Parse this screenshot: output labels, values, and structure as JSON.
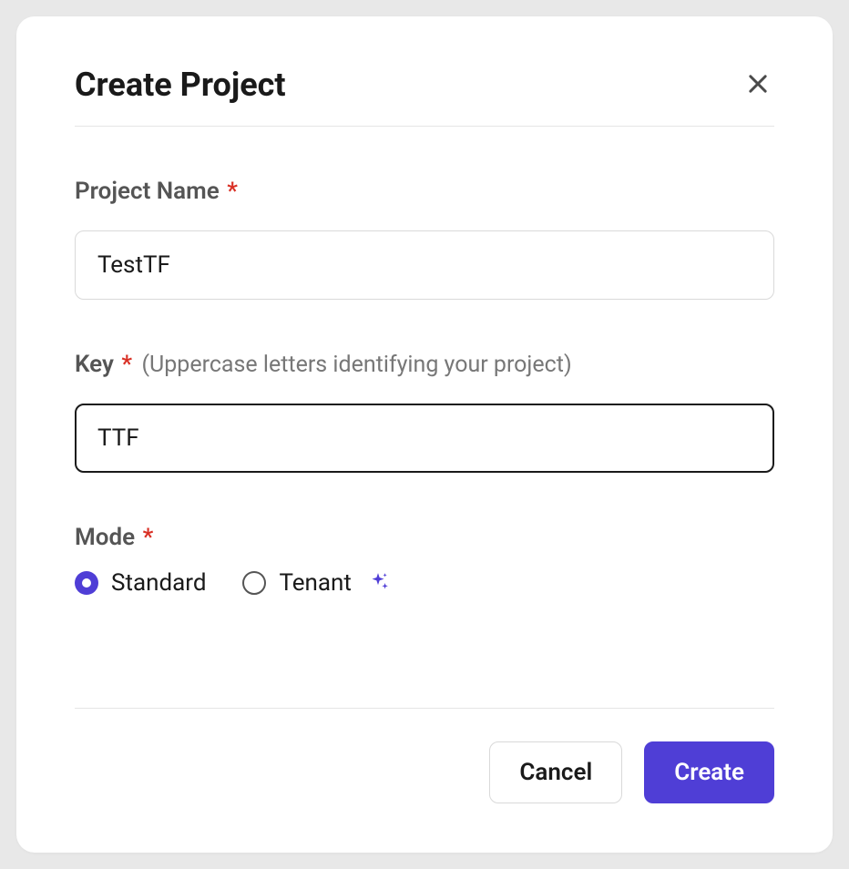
{
  "modal": {
    "title": "Create Project",
    "fields": {
      "projectName": {
        "label": "Project Name",
        "value": "TestTF"
      },
      "key": {
        "label": "Key",
        "hint": "(Uppercase letters identifying your project)",
        "value": "TTF"
      },
      "mode": {
        "label": "Mode",
        "options": {
          "standard": "Standard",
          "tenant": "Tenant"
        },
        "selected": "standard"
      }
    },
    "footer": {
      "cancel": "Cancel",
      "create": "Create"
    }
  }
}
